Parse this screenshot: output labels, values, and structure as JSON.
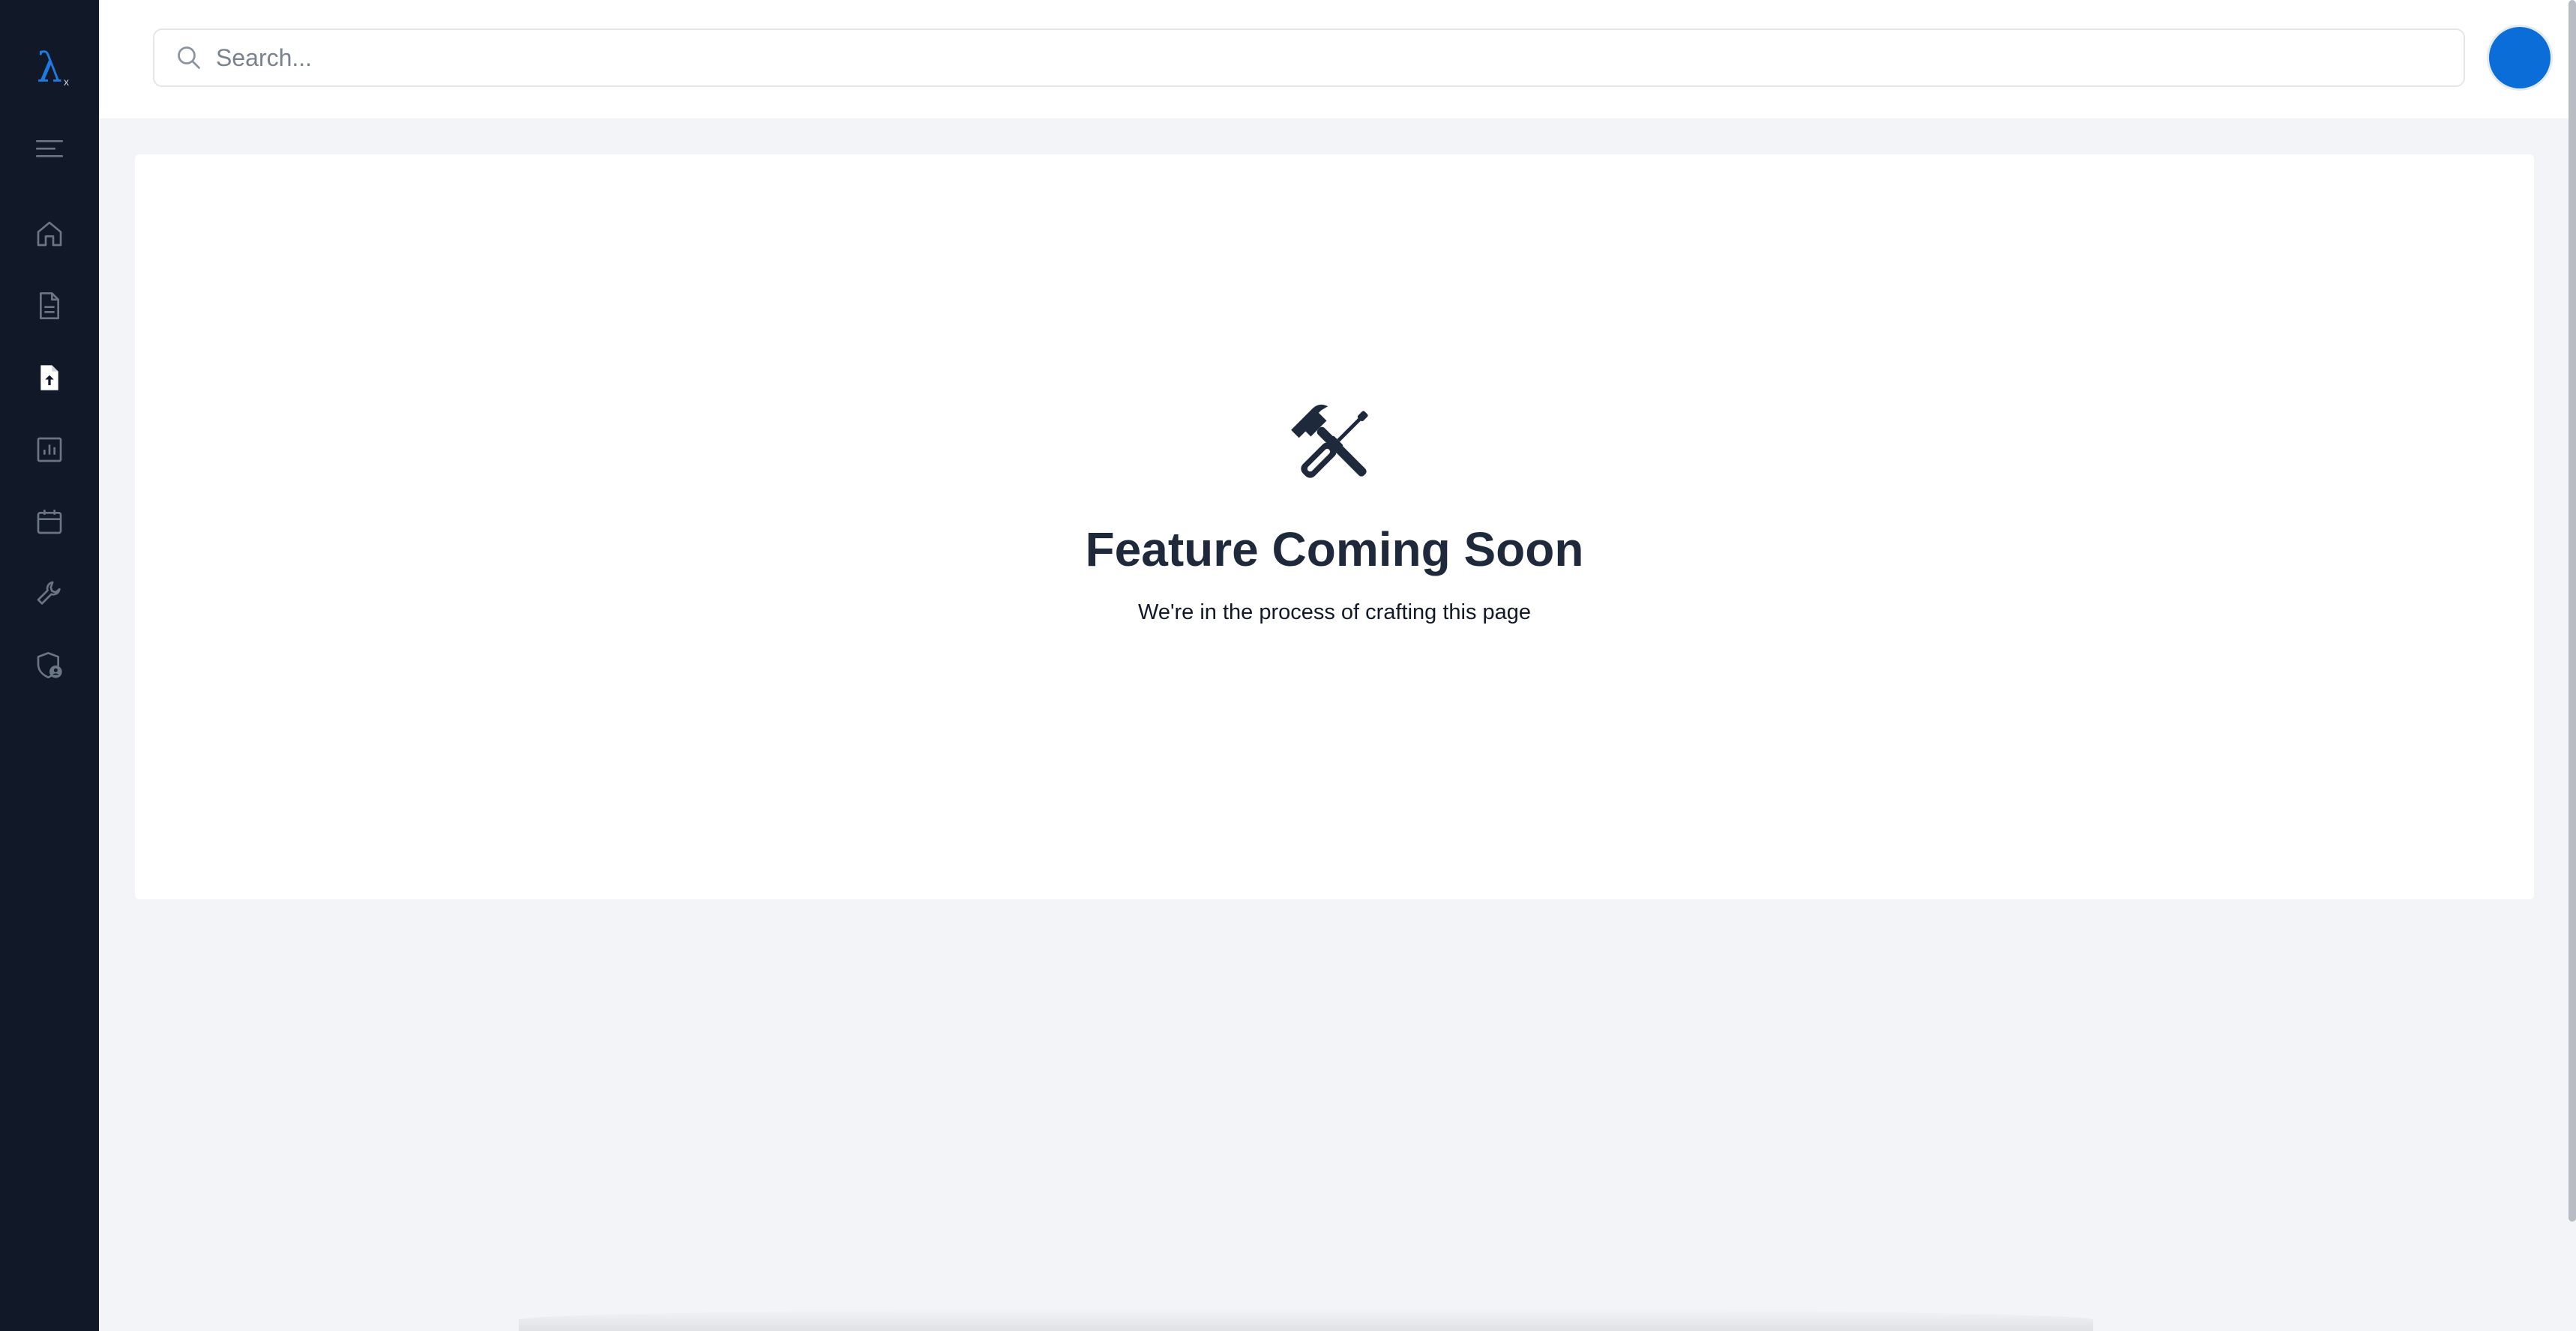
{
  "app": {
    "logo_text": "λ",
    "logo_subscript": "x"
  },
  "search": {
    "placeholder": "Search..."
  },
  "sidebar": {
    "items": [
      {
        "icon": "home-icon",
        "active": false
      },
      {
        "icon": "document-icon",
        "active": false
      },
      {
        "icon": "file-upload-icon",
        "active": true
      },
      {
        "icon": "chart-icon",
        "active": false
      },
      {
        "icon": "calendar-icon",
        "active": false
      },
      {
        "icon": "wrench-icon",
        "active": false
      },
      {
        "icon": "shield-user-icon",
        "active": false
      }
    ]
  },
  "main": {
    "title": "Feature Coming Soon",
    "subtitle": "We're in the process of crafting this page"
  },
  "colors": {
    "sidebar_bg": "#111827",
    "accent": "#0b6ed8",
    "icon_inactive": "#6b7684",
    "icon_active": "#ffffff",
    "heading": "#1e293b"
  }
}
